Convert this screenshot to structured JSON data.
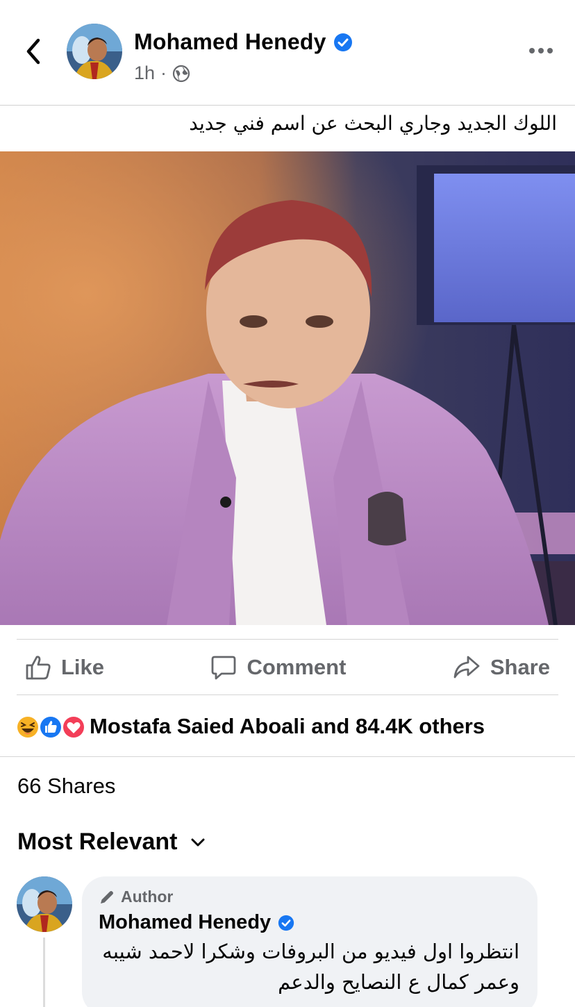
{
  "post": {
    "author": "Mohamed Henedy",
    "time": "1h",
    "separator": "·",
    "caption": "اللوك الجديد وجاري البحث عن اسم فني جديد"
  },
  "actions": {
    "like": "Like",
    "comment": "Comment",
    "share": "Share"
  },
  "reactions": {
    "icons": [
      "haha-icon",
      "like-reaction-icon",
      "love-icon"
    ],
    "summary": "Mostafa Saied Aboali and 84.4K others"
  },
  "shares": "66 Shares",
  "sort": {
    "label": "Most Relevant"
  },
  "comment": {
    "badge": "Author",
    "name": "Mohamed Henedy",
    "text": "انتظروا اول فيديو من البروفات وشكرا لاحمد شيبه وعمر كمال ع النصايح والدعم"
  },
  "colors": {
    "verified": "#1877f2",
    "secondary_text": "#65676b",
    "bubble": "#f0f2f5",
    "love": "#f33e58",
    "haha": "#f7b125"
  }
}
